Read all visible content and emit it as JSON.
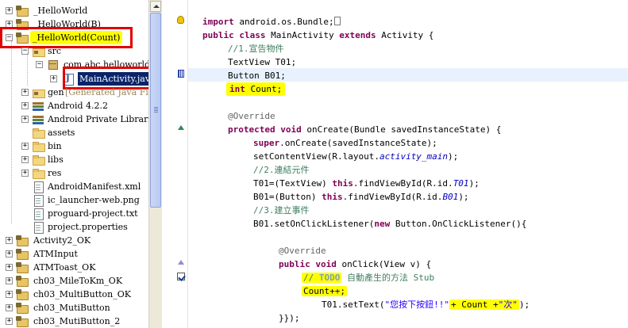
{
  "explorer": {
    "items": [
      {
        "label": "_HelloWorld"
      },
      {
        "label": "_HelloWorld(B)"
      },
      {
        "label": "_HelloWorld(Count)"
      },
      {
        "label": "src"
      },
      {
        "label": "com.abc.helloworld"
      },
      {
        "label": "MainActivity.java"
      },
      {
        "label": "gen",
        "suffix": "[Generated Java Files]"
      },
      {
        "label": "Android 4.2.2"
      },
      {
        "label": "Android Private Libraries"
      },
      {
        "label": "assets"
      },
      {
        "label": "bin"
      },
      {
        "label": "libs"
      },
      {
        "label": "res"
      },
      {
        "label": "AndroidManifest.xml"
      },
      {
        "label": "ic_launcher-web.png"
      },
      {
        "label": "proguard-project.txt"
      },
      {
        "label": "project.properties"
      },
      {
        "label": "Activity2_OK"
      },
      {
        "label": "ATMInput"
      },
      {
        "label": "ATMToast_OK"
      },
      {
        "label": "ch03_MileToKm_OK"
      },
      {
        "label": "ch03_MultiButton_OK"
      },
      {
        "label": "ch03_MutiButton"
      },
      {
        "label": "ch03_MutiButton_2"
      }
    ]
  },
  "editor": {
    "lines": [
      {
        "kw1": "import",
        "text": " android.os.Bundle;"
      },
      {
        "kw1": "public",
        "kw2": "class",
        "text1": " MainActivity ",
        "kw3": "extends",
        "text2": " Activity {"
      },
      {
        "comment": "//1.宣告物件"
      },
      {
        "text": "TextView T01;"
      },
      {
        "text": "Button B01;"
      },
      {
        "kw": "int",
        "text": " Count;"
      },
      {
        "annotation": "@Override"
      },
      {
        "kw1": "protected",
        "kw2": "void",
        "text": " onCreate(Bundle savedInstanceState) {"
      },
      {
        "kw": "super",
        "text": ".onCreate(savedInstanceState);"
      },
      {
        "text1": "setContentView(R.layout.",
        "field": "activity_main",
        "text2": ");"
      },
      {
        "comment": "//2.連結元件"
      },
      {
        "text1": "T01=(TextView) ",
        "kw": "this",
        "text2": ".findViewById(R.id.",
        "field": "T01",
        "text3": ");"
      },
      {
        "text1": "B01=(Button) ",
        "kw": "this",
        "text2": ".findViewById(R.id.",
        "field": "B01",
        "text3": ");"
      },
      {
        "comment": "//3.建立事件"
      },
      {
        "text1": "B01.setOnClickListener(",
        "kw": "new",
        "text2": " Button.OnClickListener(){"
      },
      {
        "annotation": "@Override"
      },
      {
        "kw1": "public",
        "kw2": "void",
        "text": " onClick(View v) {"
      },
      {
        "comment1": "// ",
        "todo": "TODO",
        "comment2": " 自動產生的方法 Stub"
      },
      {
        "text": "Count++;"
      },
      {
        "text1": "T01.setText(",
        "string1": "\"您按下按鈕!!\"",
        "text2": "+ Count +",
        "string2": "\"次\"",
        "text3": ");"
      },
      {
        "text": "}});"
      }
    ]
  },
  "colors": {
    "highlight": "#ffff00",
    "annotation_box": "#e00000",
    "keyword": "#7f0055",
    "comment": "#3f7f5f",
    "string": "#2a00ff",
    "field": "#0000c0",
    "selection": "#0a246a",
    "current_line": "#e8f2fe"
  }
}
